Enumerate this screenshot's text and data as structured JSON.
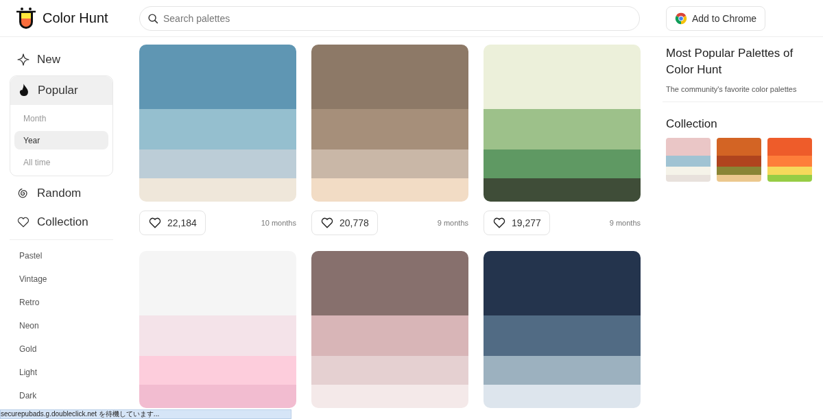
{
  "header": {
    "logo_text": "Color Hunt",
    "search": {
      "placeholder": "Search palettes"
    },
    "chrome_button": "Add to Chrome"
  },
  "sidebar": {
    "nav": [
      {
        "kind": "new",
        "label": "New",
        "selected": false
      },
      {
        "kind": "popular",
        "label": "Popular",
        "selected": true,
        "children": [
          {
            "label": "Month",
            "selected": false
          },
          {
            "label": "Year",
            "selected": true
          },
          {
            "label": "All time",
            "selected": false
          }
        ]
      },
      {
        "kind": "random",
        "label": "Random",
        "selected": false
      },
      {
        "kind": "collection",
        "label": "Collection",
        "selected": false
      }
    ],
    "categories": [
      "Pastel",
      "Vintage",
      "Retro",
      "Neon",
      "Gold",
      "Light",
      "Dark"
    ]
  },
  "palettes": [
    {
      "colors": [
        {
          "color": "#5f96b3"
        },
        {
          "color": "#95bfcf"
        },
        {
          "color": "#bccdd7"
        },
        {
          "color": "#efe7da"
        }
      ],
      "likes": "22,184",
      "age": "10 months"
    },
    {
      "colors": [
        {
          "color": "#8d7967"
        },
        {
          "color": "#a68f7a"
        },
        {
          "color": "#c9b7a7"
        },
        {
          "color": "#f2dcc5"
        }
      ],
      "likes": "20,778",
      "age": "9 months"
    },
    {
      "colors": [
        {
          "color": "#ecf0da"
        },
        {
          "color": "#9dc18a"
        },
        {
          "color": "#5f9963"
        },
        {
          "color": "#3f4d38"
        }
      ],
      "likes": "19,277",
      "age": "9 months"
    },
    {
      "colors": [
        {
          "color": "#f5f5f5"
        },
        {
          "color": "#f4e3e9"
        },
        {
          "color": "#fdcddc"
        },
        {
          "color": "#f2bcd0"
        }
      ]
    },
    {
      "colors": [
        {
          "color": "#87706d"
        },
        {
          "color": "#d8b5b7"
        },
        {
          "color": "#e5d0d1"
        },
        {
          "color": "#f4e9e9"
        }
      ]
    },
    {
      "colors": [
        {
          "color": "#24344d"
        },
        {
          "color": "#516b84"
        },
        {
          "color": "#9cb1bf"
        },
        {
          "color": "#dde5ed"
        }
      ]
    }
  ],
  "right_panel": {
    "title": "Most Popular Palettes of Color Hunt",
    "subtitle": "The community's favorite color palettes",
    "collection_title": "Collection",
    "collection": [
      {
        "colors": [
          {
            "color": "#eac6c6"
          },
          {
            "color": "#a0c3d3"
          },
          {
            "color": "#f5f3e9"
          },
          {
            "color": "#e8e1dc"
          }
        ]
      },
      {
        "colors": [
          {
            "color": "#d36424"
          },
          {
            "color": "#b0441e"
          },
          {
            "color": "#8a8535"
          },
          {
            "color": "#ecc88e"
          }
        ]
      },
      {
        "colors": [
          {
            "color": "#ee5c2a"
          },
          {
            "color": "#fe7e3a"
          },
          {
            "color": "#f6d95b"
          },
          {
            "color": "#97cd45"
          }
        ]
      }
    ]
  },
  "status_bar": "securepubads.g.doubleclick.net を待機しています..."
}
